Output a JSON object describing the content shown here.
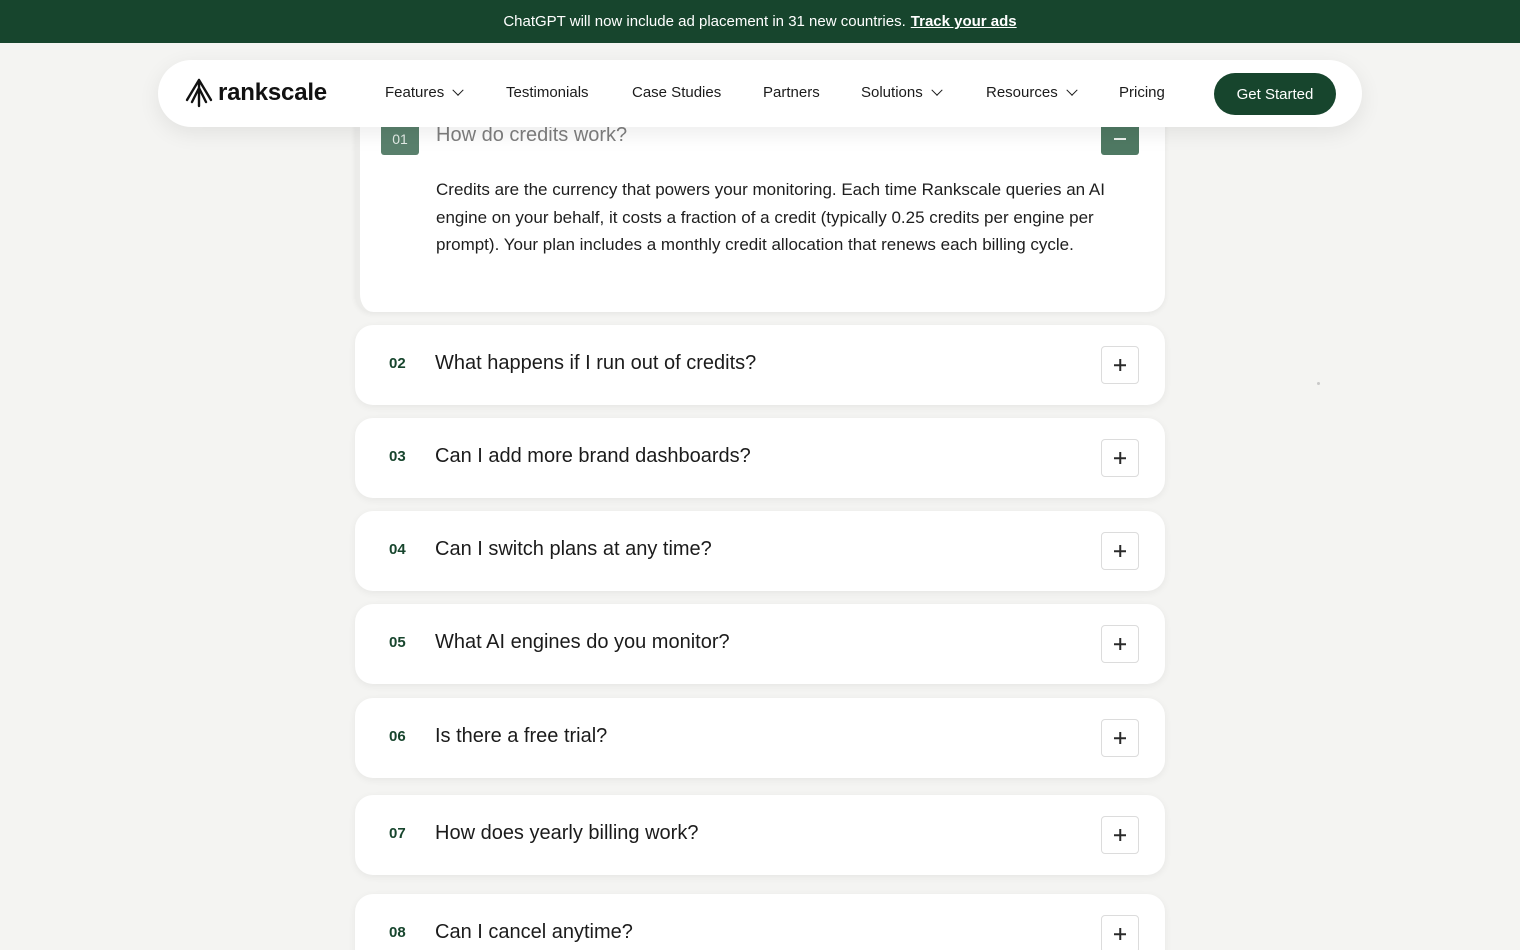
{
  "announcement": {
    "text": "ChatGPT will now include ad placement in 31 new countries.",
    "link_label": "Track your ads"
  },
  "nav": {
    "logo_text": "rankscale",
    "items": [
      {
        "label": "Features",
        "has_dropdown": true
      },
      {
        "label": "Testimonials",
        "has_dropdown": false
      },
      {
        "label": "Case Studies",
        "has_dropdown": false
      },
      {
        "label": "Partners",
        "has_dropdown": false
      },
      {
        "label": "Solutions",
        "has_dropdown": true
      },
      {
        "label": "Resources",
        "has_dropdown": true
      },
      {
        "label": "Pricing",
        "has_dropdown": false
      }
    ],
    "cta_label": "Get Started"
  },
  "faq": {
    "open_item": {
      "number": "01",
      "question": "How do credits work?",
      "answer": "Credits are the currency that powers your monitoring. Each time Rankscale queries an AI engine on your behalf, it costs a fraction of a credit (typically 0.25 credits per engine per prompt). Your plan includes a monthly credit allocation that renews each billing cycle."
    },
    "items": [
      {
        "number": "02",
        "question": "What happens if I run out of credits?"
      },
      {
        "number": "03",
        "question": "Can I add more brand dashboards?"
      },
      {
        "number": "04",
        "question": "Can I switch plans at any time?"
      },
      {
        "number": "05",
        "question": "What AI engines do you monitor?"
      },
      {
        "number": "06",
        "question": "Is there a free trial?"
      },
      {
        "number": "07",
        "question": "How does yearly billing work?"
      },
      {
        "number": "08",
        "question": "Can I cancel anytime?"
      }
    ]
  },
  "colors": {
    "brand_green": "#17452d",
    "background": "#f4f4f2"
  }
}
